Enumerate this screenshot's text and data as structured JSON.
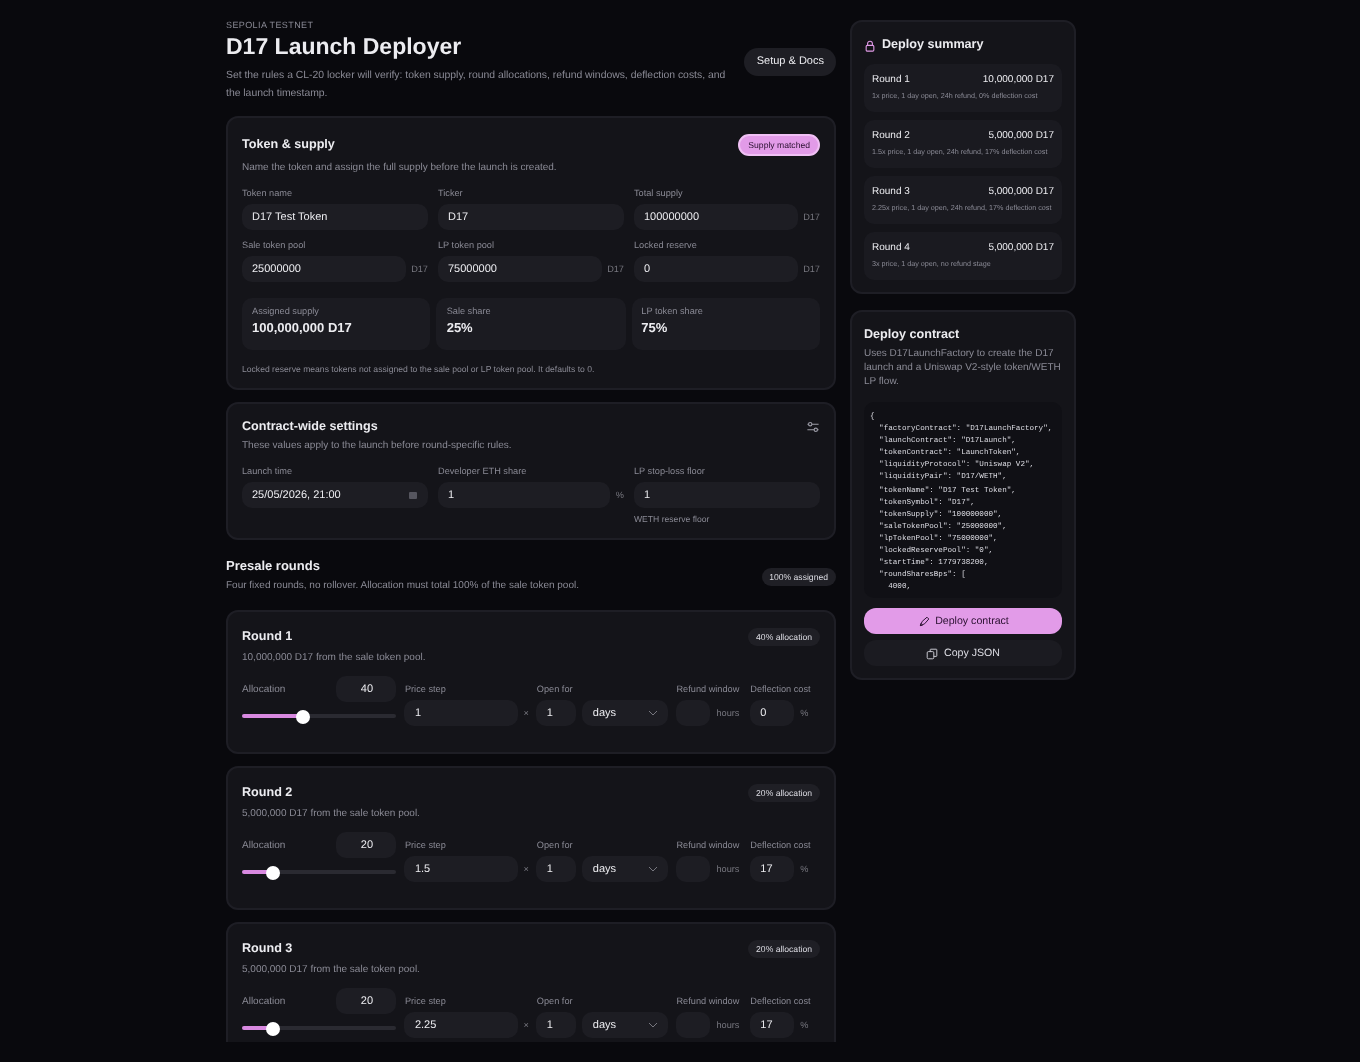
{
  "header": {
    "network": "SEPOLIA TESTNET",
    "title": "D17 Launch Deployer",
    "description": "Set the rules a CL-20 locker will verify: token supply, round allocations, refund windows, deflection costs, and the launch timestamp.",
    "docs_button": "Setup & Docs"
  },
  "token_supply": {
    "title": "Token & supply",
    "subtitle": "Name the token and assign the full supply before the launch is created.",
    "badge": "Supply matched",
    "fields": [
      {
        "label": "Token name",
        "value": "D17 Test Token"
      },
      {
        "label": "Ticker",
        "value": "D17"
      },
      {
        "label": "Total supply",
        "value": "100000000",
        "unit": "D17"
      },
      {
        "label": "Sale token pool",
        "value": "25000000",
        "unit": "D17"
      },
      {
        "label": "LP token pool",
        "value": "75000000",
        "unit": "D17"
      },
      {
        "label": "Locked reserve",
        "value": "0",
        "unit": "D17"
      }
    ],
    "stats": [
      {
        "label": "Assigned supply",
        "value": "100,000,000 D17"
      },
      {
        "label": "Sale share",
        "value": "25%"
      },
      {
        "label": "LP token share",
        "value": "75%"
      }
    ],
    "note": "Locked reserve means tokens not assigned to the sale pool or LP token pool. It defaults to 0."
  },
  "contract_settings": {
    "title": "Contract-wide settings",
    "subtitle": "These values apply to the launch before round-specific rules.",
    "fields": [
      {
        "kind": "datetime",
        "label": "Launch time",
        "value": "25/05/2026, 21:00"
      },
      {
        "kind": "number",
        "label": "Developer ETH share",
        "value": "1",
        "unit": "%"
      },
      {
        "kind": "number",
        "label": "LP stop-loss floor",
        "value": "1",
        "hint": "WETH reserve floor"
      }
    ]
  },
  "presale": {
    "title": "Presale rounds",
    "subtitle": "Four fixed rounds, no rollover. Allocation must total 100% of the sale token pool.",
    "badge": "100% assigned",
    "rounds": [
      {
        "title": "Round 1",
        "badge": "40% allocation",
        "subtitle": "10,000,000 D17 from the sale token pool.",
        "allocation": {
          "label": "Allocation",
          "value": "40",
          "level": 0.4
        },
        "price_step": {
          "label": "Price step",
          "value": "1",
          "suffix": "×"
        },
        "open_for": {
          "label": "Open for",
          "value": "1",
          "unit": "days"
        },
        "refund_window": {
          "label": "Refund window",
          "suffix": "hours"
        },
        "deflection_cost": {
          "label": "Deflection cost",
          "value": "0",
          "suffix": "%"
        }
      },
      {
        "title": "Round 2",
        "badge": "20% allocation",
        "subtitle": "5,000,000 D17 from the sale token pool.",
        "allocation": {
          "label": "Allocation",
          "value": "20",
          "level": 0.2
        },
        "price_step": {
          "label": "Price step",
          "value": "1.5",
          "suffix": "×"
        },
        "open_for": {
          "label": "Open for",
          "value": "1",
          "unit": "days"
        },
        "refund_window": {
          "label": "Refund window",
          "suffix": "hours"
        },
        "deflection_cost": {
          "label": "Deflection cost",
          "value": "17",
          "suffix": "%"
        }
      },
      {
        "title": "Round 3",
        "badge": "20% allocation",
        "subtitle": "5,000,000 D17 from the sale token pool.",
        "allocation": {
          "label": "Allocation",
          "value": "20",
          "level": 0.2
        },
        "price_step": {
          "label": "Price step",
          "value": "2.25",
          "suffix": "×"
        },
        "open_for": {
          "label": "Open for",
          "value": "1",
          "unit": "days"
        },
        "refund_window": {
          "label": "Refund window",
          "suffix": "hours"
        },
        "deflection_cost": {
          "label": "Deflection cost",
          "value": "17",
          "suffix": "%"
        }
      }
    ]
  },
  "deploy_summary": {
    "title": "Deploy summary",
    "rounds": [
      {
        "name": "Round 1",
        "amount": "10,000,000 D17",
        "details": "1x price, 1 day open, 24h refund, 0% deflection cost"
      },
      {
        "name": "Round 2",
        "amount": "5,000,000 D17",
        "details": "1.5x price, 1 day open, 24h refund, 17% deflection cost"
      },
      {
        "name": "Round 3",
        "amount": "5,000,000 D17",
        "details": "2.25x price, 1 day open, 24h refund, 17% deflection cost"
      },
      {
        "name": "Round 4",
        "amount": "5,000,000 D17",
        "details": "3x price, 1 day open, no refund stage"
      }
    ]
  },
  "deploy_contract": {
    "title": "Deploy contract",
    "description": "Uses D17LaunchFactory to create the D17 launch and a Uniswap V2-style token/WETH LP flow.",
    "code_lines": [
      "{",
      "  \"factoryContract\": \"D17LaunchFactory\",",
      "  \"launchContract\": \"D17Launch\",",
      "  \"tokenContract\": \"LaunchToken\",",
      "  \"liquidityProtocol\": \"Uniswap V2\",",
      "  \"liquidityPair\": \"D17/WETH\",",
      "  \"tokenName\": \"D17 Test Token\",",
      "  \"tokenSymbol\": \"D17\",",
      "  \"tokenSupply\": \"100000000\",",
      "  \"saleTokenPool\": \"25000000\",",
      "  \"lpTokenPool\": \"75000000\",",
      "  \"lockedReservePool\": \"0\",",
      "  \"startTime\": 1779738200,",
      "  \"roundSharesBps\": [",
      "    4000,"
    ],
    "deploy_button": "Deploy contract",
    "copy_button": "Copy JSON"
  }
}
